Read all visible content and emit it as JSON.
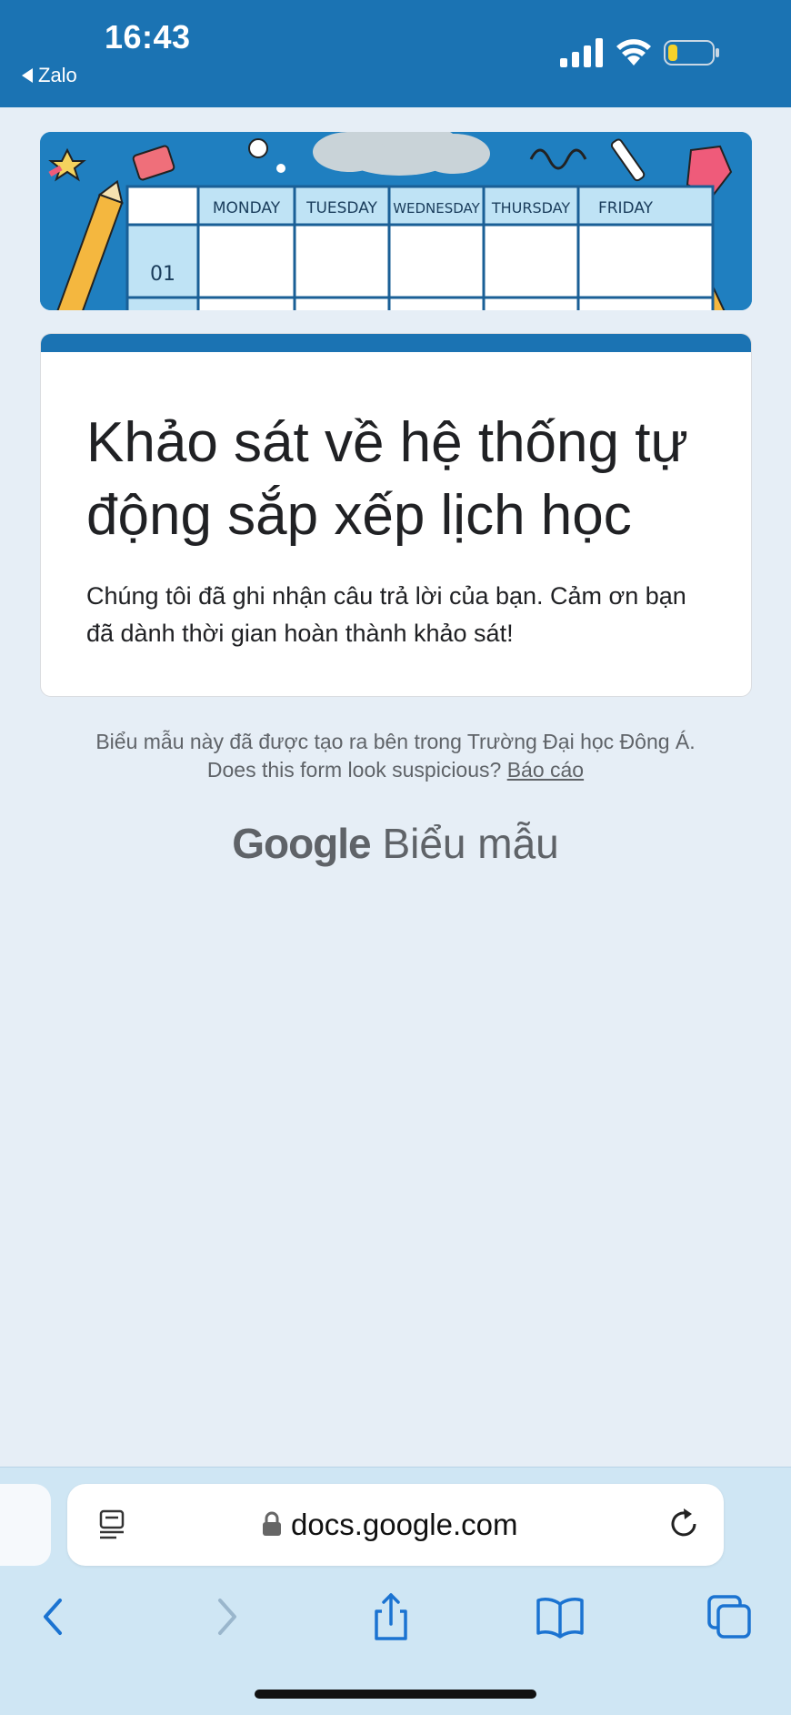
{
  "status_bar": {
    "time": "16:43",
    "back_app": "Zalo"
  },
  "banner": {
    "days": [
      "MONDAY",
      "TUESDAY",
      "WEDNESDAY",
      "THURSDAY",
      "FRIDAY"
    ],
    "row_label": "01"
  },
  "card": {
    "title": "Khảo sát về hệ thống tự động sắp xếp lịch học",
    "message": "Chúng tôi đã ghi nhận câu trả lời của bạn. Cảm ơn bạn đã dành thời gian hoàn thành khảo sát!"
  },
  "footer": {
    "created_in": "Biểu mẫu này đã được tạo ra bên trong Trường Đại học Đông Á.",
    "suspicious": "Does this form look suspicious?",
    "report_link": "Báo cáo",
    "brand_google": "Google",
    "brand_forms": "Biểu mẫu"
  },
  "browser": {
    "url": "docs.google.com"
  },
  "colors": {
    "accent": "#1b73b3",
    "page_bg": "#e6eef6",
    "toolbar_bg": "#cfe6f4",
    "icon_blue": "#1b73d1"
  },
  "icons": {
    "reader": "reader-mode-icon",
    "lock": "lock-icon",
    "reload": "reload-icon",
    "back": "chevron-left-icon",
    "forward": "chevron-right-icon",
    "share": "share-icon",
    "bookmarks": "book-icon",
    "tabs": "tabs-icon"
  }
}
